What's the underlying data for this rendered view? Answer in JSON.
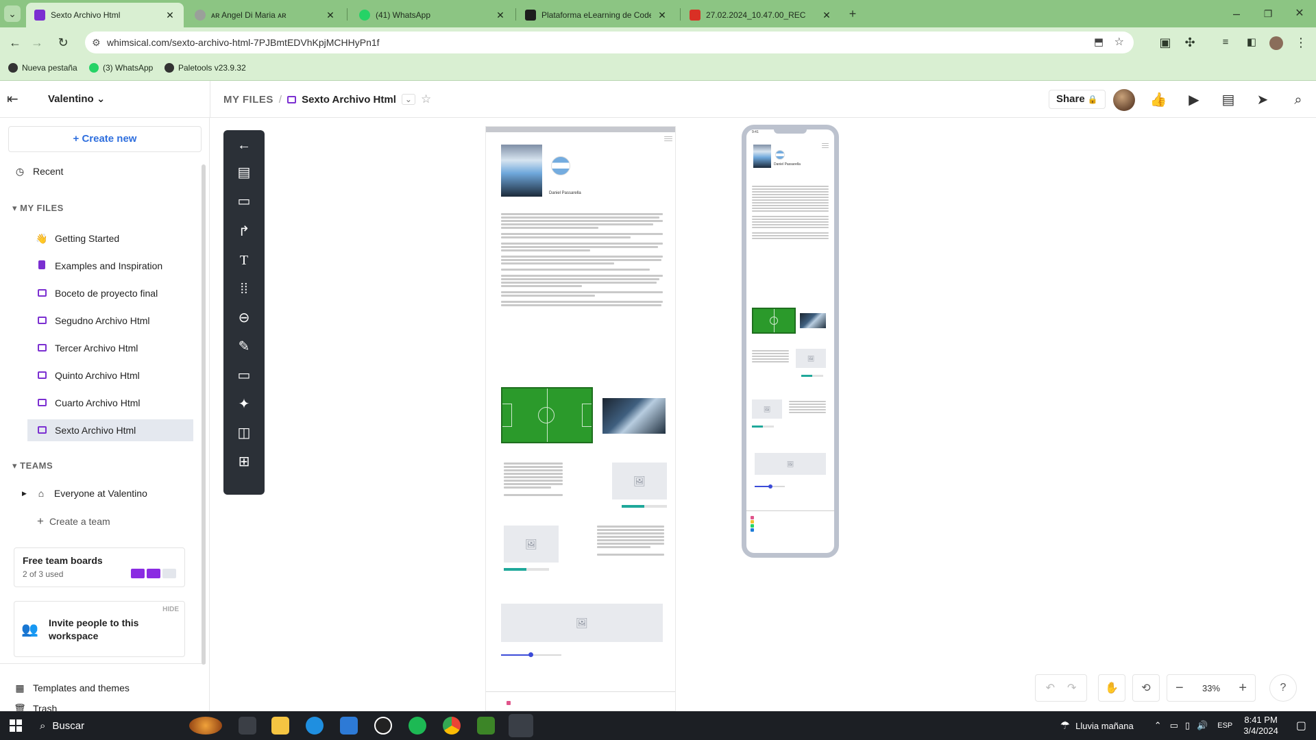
{
  "browser": {
    "tabs": [
      {
        "title": "Sexto Archivo Html",
        "active": true,
        "color": "#7b2fd1"
      },
      {
        "title": "ᴀʀ Angel Di Maria ᴀʀ",
        "active": false,
        "color": "#9aa09a"
      },
      {
        "title": "(41) WhatsApp",
        "active": false,
        "color": "#25d366"
      },
      {
        "title": "Plataforma eLearning de Coder",
        "active": false,
        "color": "#1d1d1d"
      },
      {
        "title": "27.02.2024_10.47.00_REC",
        "active": false,
        "color": "#d93025"
      }
    ],
    "url": "whimsical.com/sexto-archivo-html-7PJBmtEDVhKpjMCHHyPn1f",
    "bookmarks": [
      {
        "label": "Nueva pestaña",
        "color": "#333333"
      },
      {
        "label": "(3) WhatsApp",
        "color": "#25d366"
      },
      {
        "label": "Paletools v23.9.32",
        "color": "#333333"
      }
    ]
  },
  "header": {
    "workspace": "Valentino",
    "crumb_root": "MY FILES",
    "doc_title": "Sexto Archivo Html",
    "share": "Share"
  },
  "sidebar": {
    "create_new": "Create new",
    "recent": "Recent",
    "my_files_heading": "MY FILES",
    "files": [
      {
        "label": "Getting Started",
        "icon": "wave-hand-icon",
        "selected": false
      },
      {
        "label": "Examples and Inspiration",
        "icon": "doc-icon",
        "selected": false
      },
      {
        "label": "Boceto de proyecto final",
        "icon": "board-icon",
        "selected": false
      },
      {
        "label": "Segudno Archivo Html",
        "icon": "board-icon",
        "selected": false
      },
      {
        "label": "Tercer Archivo Html",
        "icon": "board-icon",
        "selected": false
      },
      {
        "label": "Quinto Archivo Html",
        "icon": "board-icon",
        "selected": false
      },
      {
        "label": "Cuarto Archivo Html",
        "icon": "board-icon",
        "selected": false
      },
      {
        "label": "Sexto Archivo Html",
        "icon": "board-icon",
        "selected": true
      }
    ],
    "teams_heading": "TEAMS",
    "team": "Everyone at Valentino",
    "create_team": "Create a team",
    "free_boards_title": "Free team boards",
    "free_boards_usage": "2 of 3 used",
    "free_boards_used": 2,
    "free_boards_total": 3,
    "invite_hide": "HIDE",
    "invite_text": "Invite people to this workspace",
    "templates": "Templates and themes",
    "trash": "Trash"
  },
  "canvas": {
    "person_name": "Daniel Passarella",
    "phone_time": "9:41",
    "zoom": "33%"
  },
  "taskbar": {
    "search": "Buscar",
    "weather": "Lluvia mañana",
    "lang": "ESP",
    "time": "8:41 PM",
    "date": "3/4/2024"
  },
  "colors": {
    "tab_strip": "#8cc583",
    "omnibar": "#d9efd2",
    "accent_blue": "#2f6fde",
    "board_purple": "#7b2fd1",
    "toolbar_dark": "#2b3037"
  }
}
